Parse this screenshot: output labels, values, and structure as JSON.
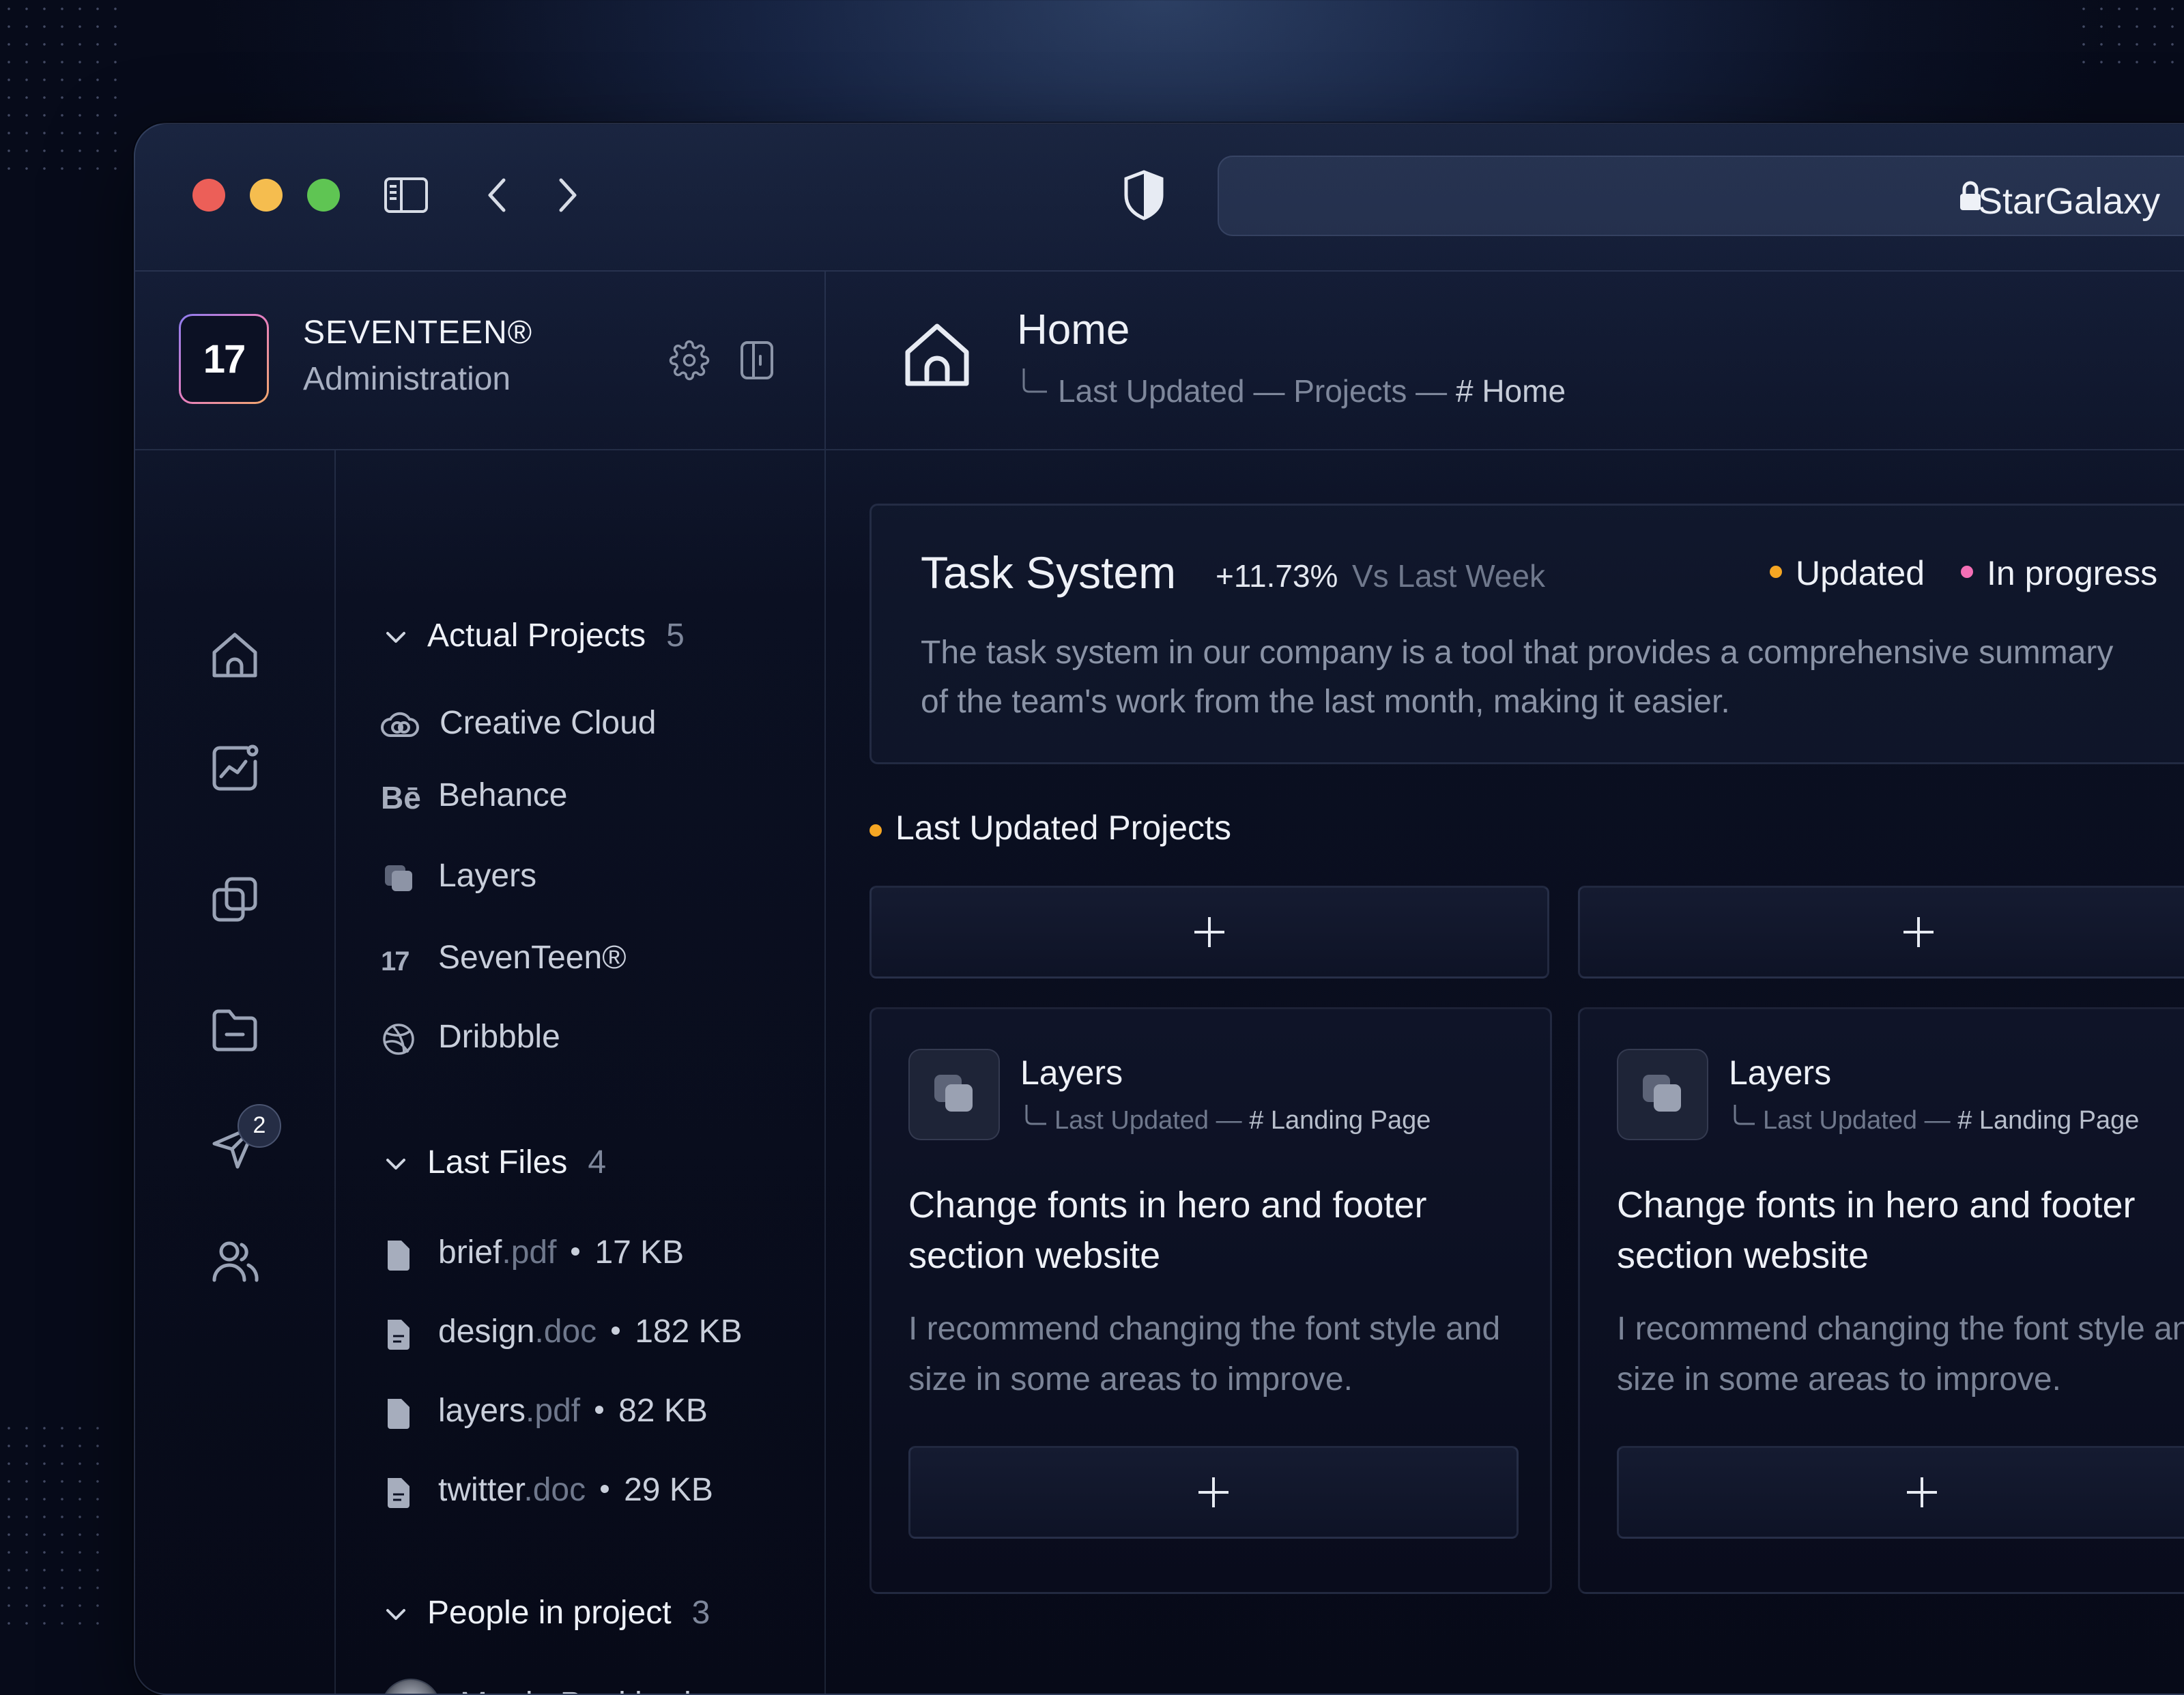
{
  "browser": {
    "url_title": "StarGalaxy",
    "traffic_lights": {
      "close": "#ec5f58",
      "minimize": "#f5bd4f",
      "zoom": "#5fc553"
    }
  },
  "org": {
    "logo_text": "17",
    "name": "SEVENTEEN®",
    "subtitle": "Administration"
  },
  "page": {
    "title": "Home",
    "crumb_1": "Last Updated",
    "crumb_sep_1": "—",
    "crumb_2": "Projects",
    "crumb_sep_2": "—",
    "crumb_3": "# Home"
  },
  "rail": {
    "icons": [
      "home-icon",
      "analytics-icon",
      "copy-icon",
      "folder-icon",
      "send-icon",
      "users-icon"
    ],
    "send_badge": "2"
  },
  "nav": {
    "projects": {
      "title": "Actual Projects",
      "count": "5",
      "items": [
        {
          "label": "Creative Cloud",
          "icon": "creative-cloud-icon"
        },
        {
          "label": "Behance",
          "icon": "behance-icon"
        },
        {
          "label": "Layers",
          "icon": "layers-icon"
        },
        {
          "label": "SevenTeen®",
          "icon": "seventeen-icon"
        },
        {
          "label": "Dribbble",
          "icon": "dribbble-icon"
        }
      ]
    },
    "files": {
      "title": "Last Files",
      "count": "4",
      "items": [
        {
          "name": "brief",
          "ext": ".pdf",
          "size": "17 KB"
        },
        {
          "name": "design",
          "ext": ".doc",
          "size": "182 KB"
        },
        {
          "name": "layers",
          "ext": ".pdf",
          "size": "82 KB"
        },
        {
          "name": "twitter",
          "ext": ".doc",
          "size": "29 KB"
        }
      ]
    },
    "people": {
      "title": "People in project",
      "count": "3",
      "items": [
        {
          "name": "Martin Pankiewicz",
          "status": "online"
        }
      ]
    }
  },
  "task": {
    "title": "Task System",
    "change": "+11.73%",
    "compare": "Vs Last Week",
    "legend_updated": "Updated",
    "legend_progress": "In progress",
    "legend_colors": {
      "updated": "#f5a623",
      "progress": "#f46fb6"
    },
    "description": "The task system in our company is a tool that provides a comprehensive summary of the team's work from the last month, making it easier."
  },
  "last_updated": {
    "title": "Last Updated Projects",
    "cards": [
      {
        "app": "Layers",
        "crumb_1": "Last Updated",
        "crumb_sep": "—",
        "crumb_2": "# Landing Page",
        "heading": "Change fonts in hero and footer section website",
        "body": "I recommend changing the font style and size in some areas to improve."
      },
      {
        "app": "Layers",
        "crumb_1": "Last Updated",
        "crumb_sep": "—",
        "crumb_2": "# Landing Page",
        "heading": "Change fonts in hero and footer section website",
        "body": "I recommend changing the font style and size in some areas to improve."
      }
    ]
  }
}
